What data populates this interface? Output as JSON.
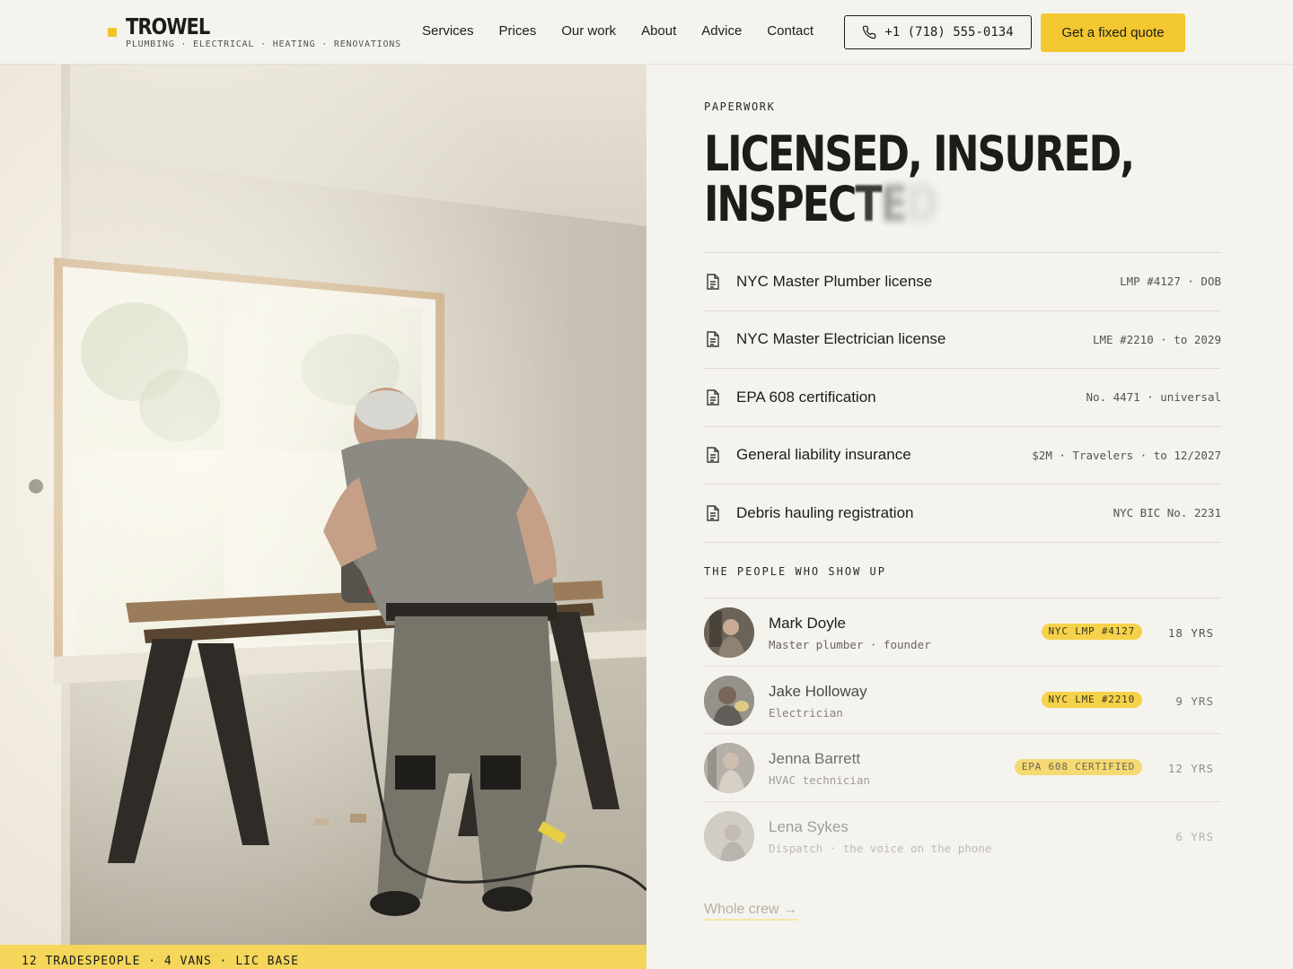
{
  "header": {
    "brand_name": "TROWEL",
    "brand_tagline": "PLUMBING · ELECTRICAL · HEATING · RENOVATIONS",
    "nav": [
      "Services",
      "Prices",
      "Our work",
      "About",
      "Advice",
      "Contact"
    ],
    "phone": "+1 (718) 555-0134",
    "cta": "Get a fixed quote"
  },
  "hero": {
    "stats": "12 TRADESPEOPLE · 4 VANS · LIC BASE"
  },
  "paperwork": {
    "eyebrow": "PAPERWORK",
    "headline_line1": "LICENSED, INSURED,",
    "headline_line2_a": "INSPEC",
    "headline_line2_b": "T",
    "headline_line2_c": "E",
    "headline_line2_d": "D",
    "items": [
      {
        "name": "NYC Master Plumber license",
        "meta": "LMP #4127 · DOB"
      },
      {
        "name": "NYC Master Electrician license",
        "meta": "LME #2210 · to 2029"
      },
      {
        "name": "EPA 608 certification",
        "meta": "No. 4471 · universal"
      },
      {
        "name": "General liability insurance",
        "meta": "$2M · Travelers · to 12/2027"
      },
      {
        "name": "Debris hauling registration",
        "meta": "NYC BIC No. 2231"
      }
    ]
  },
  "crew": {
    "title": "THE PEOPLE WHO SHOW UP",
    "members": [
      {
        "name": "Mark Doyle",
        "role": "Master plumber · founder",
        "badge": "NYC LMP #4127",
        "years": "18 YRS"
      },
      {
        "name": "Jake Holloway",
        "role": "Electrician",
        "badge": "NYC LME #2210",
        "years": "9 YRS"
      },
      {
        "name": "Jenna Barrett",
        "role": "HVAC technician",
        "badge": "EPA 608 CERTIFIED",
        "years": "12 YRS"
      },
      {
        "name": "Lena Sykes",
        "role": "Dispatch · the voice on the phone",
        "badge": "",
        "years": "6 YRS"
      }
    ],
    "link": "Whole crew →"
  },
  "colors": {
    "accent": "#f3c72f",
    "background": "#f5f3ee",
    "text": "#1c1c1a",
    "stats_bar": "#f3d65a"
  },
  "icons": {
    "phone": "phone-icon",
    "document": "document-icon",
    "brand_mark": "square-mark-icon"
  }
}
